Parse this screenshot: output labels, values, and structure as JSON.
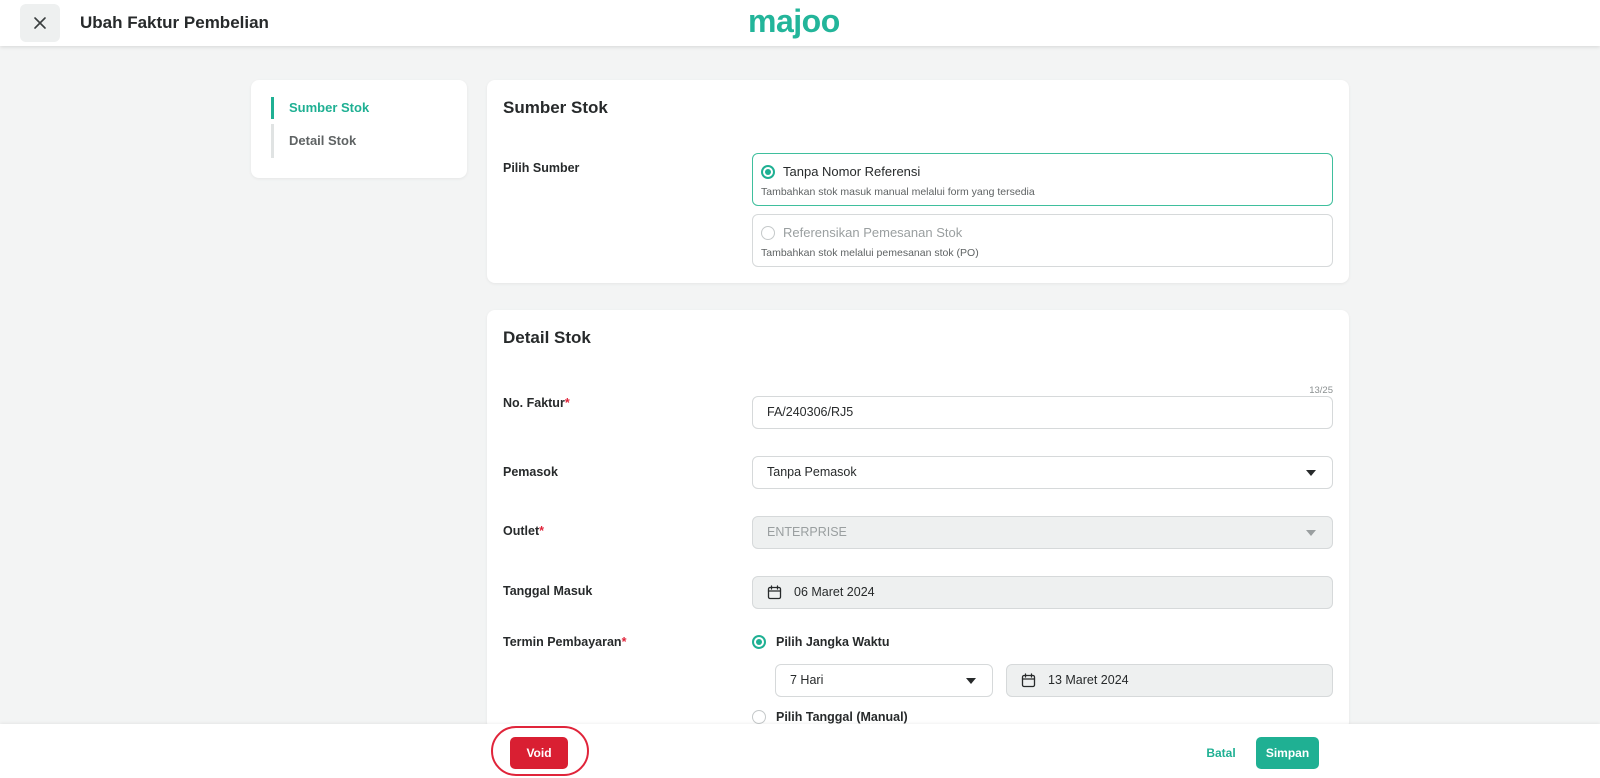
{
  "header": {
    "title": "Ubah Faktur Pembelian",
    "brand": "majoo"
  },
  "sidenav": {
    "items": [
      {
        "label": "Sumber Stok",
        "active": true
      },
      {
        "label": "Detail Stok",
        "active": false
      }
    ]
  },
  "sumber": {
    "title": "Sumber Stok",
    "field_label": "Pilih Sumber",
    "options": [
      {
        "label": "Tanpa Nomor Referensi",
        "desc": "Tambahkan stok masuk manual melalui form yang tersedia",
        "selected": true
      },
      {
        "label": "Referensikan Pemesanan Stok",
        "desc": "Tambahkan stok melalui pemesanan stok (PO)",
        "selected": false
      }
    ]
  },
  "detail": {
    "title": "Detail Stok",
    "no_faktur": {
      "label": "No. Faktur",
      "required": "*",
      "value": "FA/240306/RJ5",
      "counter": "13/25"
    },
    "pemasok": {
      "label": "Pemasok",
      "value": "Tanpa Pemasok"
    },
    "outlet": {
      "label": "Outlet",
      "required": "*",
      "value": "ENTERPRISE"
    },
    "tanggal_masuk": {
      "label": "Tanggal Masuk",
      "value": "06 Maret 2024"
    },
    "termin": {
      "label": "Termin Pembayaran",
      "required": "*",
      "option_jangka": "Pilih Jangka Waktu",
      "jangka_value": "7 Hari",
      "jangka_date": "13 Maret 2024",
      "option_manual": "Pilih Tanggal (Manual)"
    }
  },
  "footer": {
    "void_label": "Void",
    "batal_label": "Batal",
    "simpan_label": "Simpan"
  },
  "colors": {
    "accent": "#1fb093",
    "danger": "#d91f32",
    "background": "#f3f4f4"
  }
}
